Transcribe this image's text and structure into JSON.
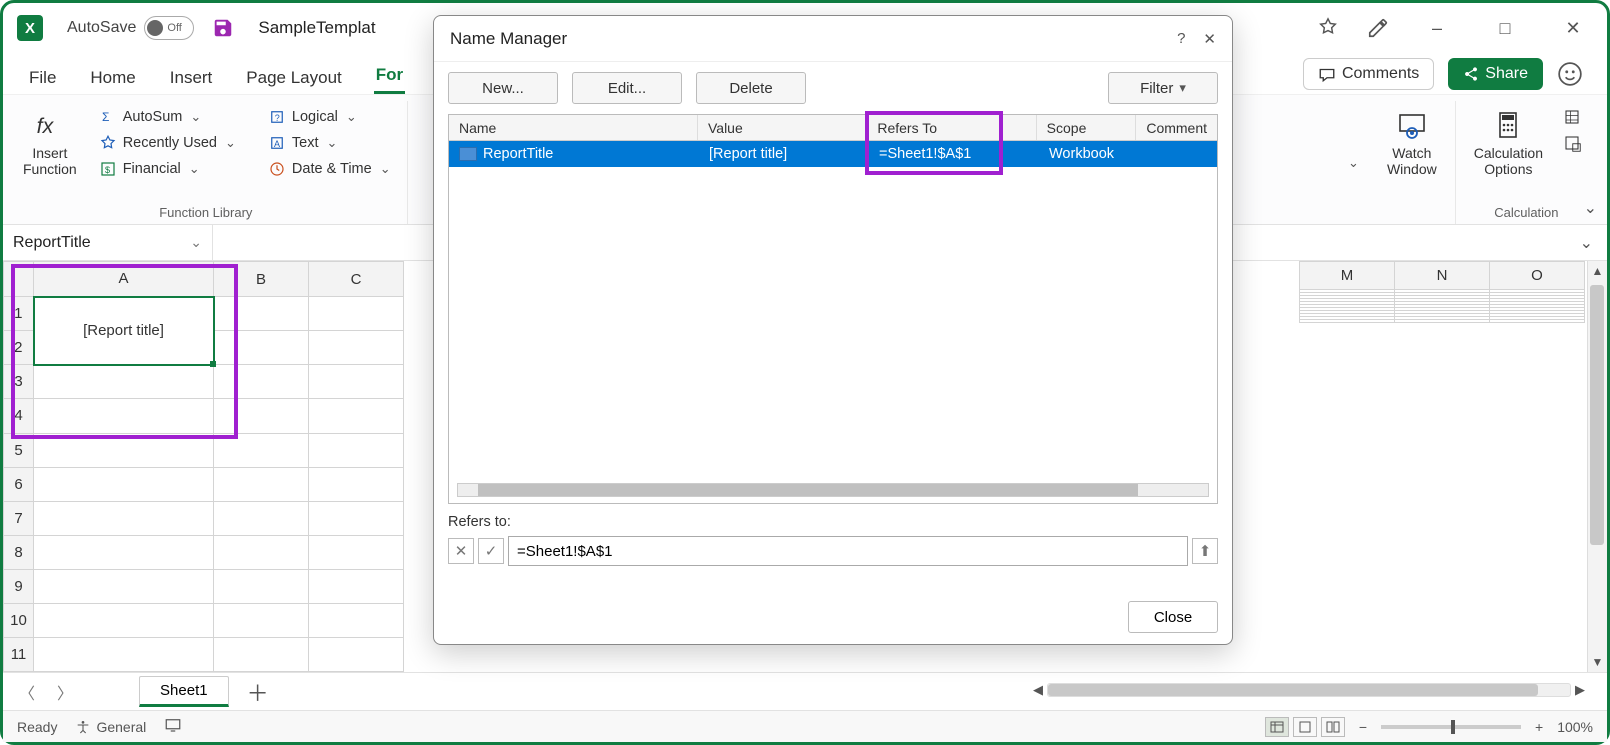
{
  "titlebar": {
    "autosave_label": "AutoSave",
    "autosave_state": "Off",
    "doc_title": "SampleTemplat"
  },
  "window_controls": {
    "minimize": "–",
    "maximize": "□",
    "close": "✕"
  },
  "ribbon_tabs": {
    "file": "File",
    "home": "Home",
    "insert": "Insert",
    "page_layout": "Page Layout",
    "formulas": "For",
    "comments": "Comments",
    "share": "Share"
  },
  "ribbon": {
    "insert_function": "Insert\nFunction",
    "autosum": "AutoSum",
    "recently_used": "Recently Used",
    "financial": "Financial",
    "logical": "Logical",
    "text": "Text",
    "date_time": "Date & Time",
    "group1_caption": "Function Library",
    "watch_window": "Watch\nWindow",
    "calc_options": "Calculation\nOptions",
    "group2_caption": "Calculation"
  },
  "namebox": "ReportTitle",
  "columns_left": [
    "A",
    "B",
    "C"
  ],
  "columns_right": [
    "M",
    "N",
    "O"
  ],
  "rows": [
    "1",
    "2",
    "3",
    "4",
    "5",
    "6",
    "7",
    "8",
    "9",
    "10",
    "11"
  ],
  "cell_A1": "[Report title]",
  "sheet_tab": "Sheet1",
  "status": {
    "ready": "Ready",
    "access": "General",
    "zoom": "100%"
  },
  "dialog": {
    "title": "Name Manager",
    "btn_new": "New...",
    "btn_edit": "Edit...",
    "btn_delete": "Delete",
    "btn_filter": "Filter",
    "col_name": "Name",
    "col_value": "Value",
    "col_refers": "Refers To",
    "col_scope": "Scope",
    "col_comment": "Comment",
    "row": {
      "name": "ReportTitle",
      "value": "[Report title]",
      "refers": "=Sheet1!$A$1",
      "scope": "Workbook",
      "comment": ""
    },
    "refers_label": "Refers to:",
    "refers_value": "=Sheet1!$A$1",
    "close": "Close",
    "help": "?",
    "x": "✕"
  }
}
